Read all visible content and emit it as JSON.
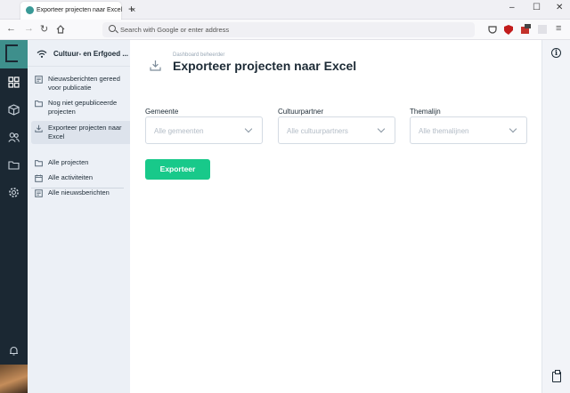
{
  "browser": {
    "tab_title": "Exporteer projecten naar Excel",
    "url_placeholder": "Search with Google or enter address"
  },
  "subnav": {
    "org_name": "Cultuur- en Erfgoed ...",
    "items": [
      {
        "label": "Nieuwsberichten gereed voor publicatie",
        "icon": "document-icon"
      },
      {
        "label": "Nog niet gepubliceerde projecten",
        "icon": "folder-icon"
      },
      {
        "label": "Exporteer projecten naar Excel",
        "icon": "download-icon",
        "active": true
      },
      {
        "label": "Alle projecten",
        "icon": "folder-icon"
      },
      {
        "label": "Alle activiteiten",
        "icon": "calendar-icon"
      },
      {
        "label": "Alle nieuwsberichten",
        "icon": "document-icon"
      }
    ]
  },
  "main": {
    "breadcrumb": "Dashboard beheerder",
    "title": "Exporteer projecten naar Excel",
    "filters": [
      {
        "label": "Gemeente",
        "placeholder": "Alle gemeenten"
      },
      {
        "label": "Cultuurpartner",
        "placeholder": "Alle cultuurpartners"
      },
      {
        "label": "Themalijn",
        "placeholder": "Alle themalijnen"
      }
    ],
    "export_button": "Exporteer"
  },
  "colors": {
    "rail": "#1b2833",
    "logo": "#3e8f8c",
    "subnav": "#ecf0f6",
    "accent_button": "#18c98a"
  }
}
